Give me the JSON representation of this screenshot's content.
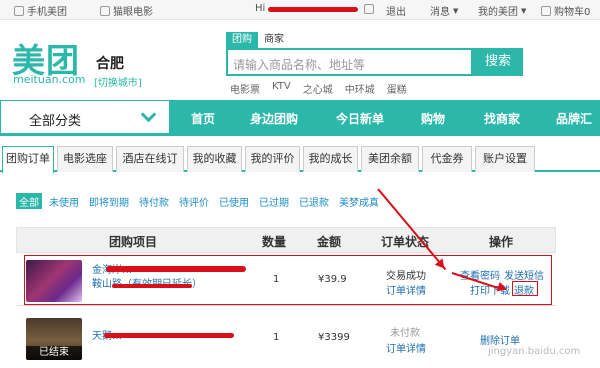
{
  "topbar": {
    "mobile_app": "手机美团",
    "movie": "猫眼电影",
    "greeting": "Hi",
    "logout": "退出",
    "messages": "消息",
    "my_meituan": "我的美团",
    "cart": "购物车0"
  },
  "header": {
    "logo": "美团",
    "logo_sub": "meituan.com",
    "city": "合肥",
    "switch_city": "[切换城市]",
    "search_tabs": [
      "团购",
      "商家"
    ],
    "search_placeholder": "请输入商品名称、地址等",
    "search_button": "搜索",
    "hot_words": [
      "电影票",
      "KTV",
      "之心城",
      "中环城",
      "蛋糕"
    ]
  },
  "nav": {
    "all_categories": "全部分类",
    "items": [
      "首页",
      "身边团购",
      "今日新单",
      "购物",
      "找商家",
      "品牌汇"
    ]
  },
  "tabs": [
    "团购订单",
    "电影选座",
    "酒店在线订",
    "我的收藏",
    "我的评价",
    "我的成长",
    "美团余额",
    "代金券",
    "账户设置"
  ],
  "filters": [
    "全部",
    "未使用",
    "即将到期",
    "待付款",
    "待评价",
    "已使用",
    "已过期",
    "已退款",
    "美梦成真"
  ],
  "table": {
    "headers": [
      "团购项目",
      "数量",
      "金额",
      "订单状态",
      "操作"
    ],
    "rows": [
      {
        "title_line1": "金海岸…",
        "title_line2": "鞍山路（有效期已延长）",
        "qty": "1",
        "amount": "¥39.9",
        "status": "交易成功",
        "detail": "订单详情",
        "actions": [
          "查看密码",
          "发送短信",
          "打印下载",
          "退款"
        ]
      },
      {
        "badge": "已结束",
        "title_line1": "天鹅…",
        "qty": "1",
        "amount": "¥3399",
        "status": "未付款",
        "detail": "订单详情",
        "actions": [
          "删除订单"
        ]
      }
    ]
  },
  "watermark": "jingyan.baidu.com",
  "colors": {
    "brand": "#2bb8aa",
    "annotation": "#d8101a",
    "link": "#1e6fb0"
  }
}
